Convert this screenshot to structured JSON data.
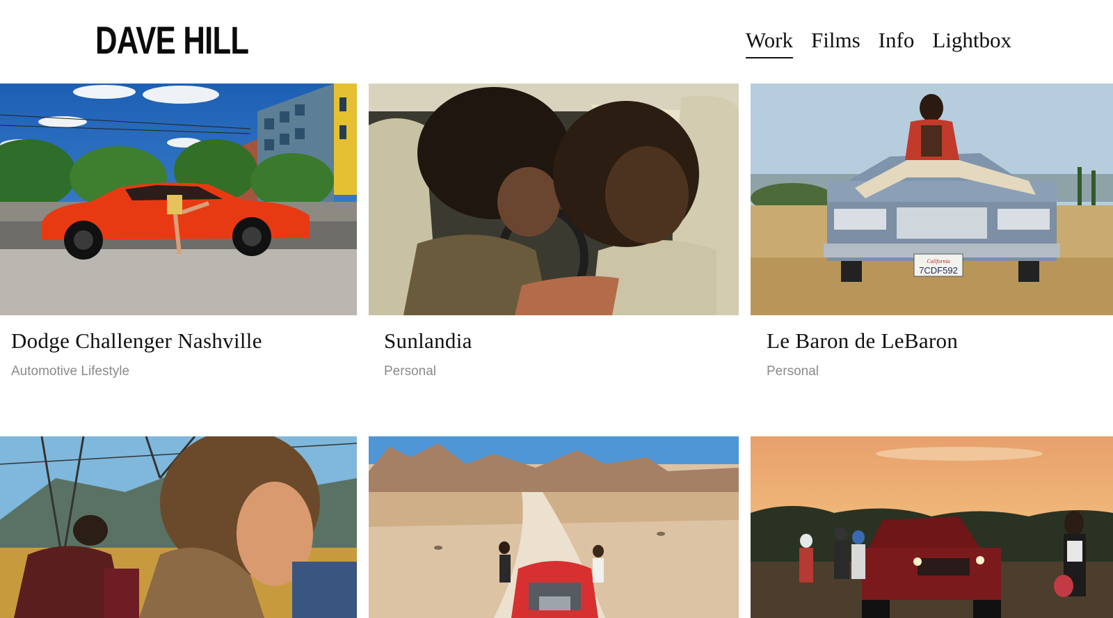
{
  "site": {
    "logo": "DAVE HILL"
  },
  "nav": {
    "items": [
      {
        "label": "Work",
        "active": true
      },
      {
        "label": "Films",
        "active": false
      },
      {
        "label": "Info",
        "active": false
      },
      {
        "label": "Lightbox",
        "active": false
      }
    ]
  },
  "projects": [
    {
      "title": "Dodge Challenger Nashville",
      "category": "Automotive Lifestyle"
    },
    {
      "title": "Sunlandia",
      "category": "Personal"
    },
    {
      "title": "Le Baron de LeBaron",
      "category": "Personal"
    },
    {
      "title": "",
      "category": ""
    },
    {
      "title": "",
      "category": ""
    },
    {
      "title": "",
      "category": ""
    }
  ],
  "plates": {
    "lebaron": "7CDF592",
    "state": "California"
  }
}
